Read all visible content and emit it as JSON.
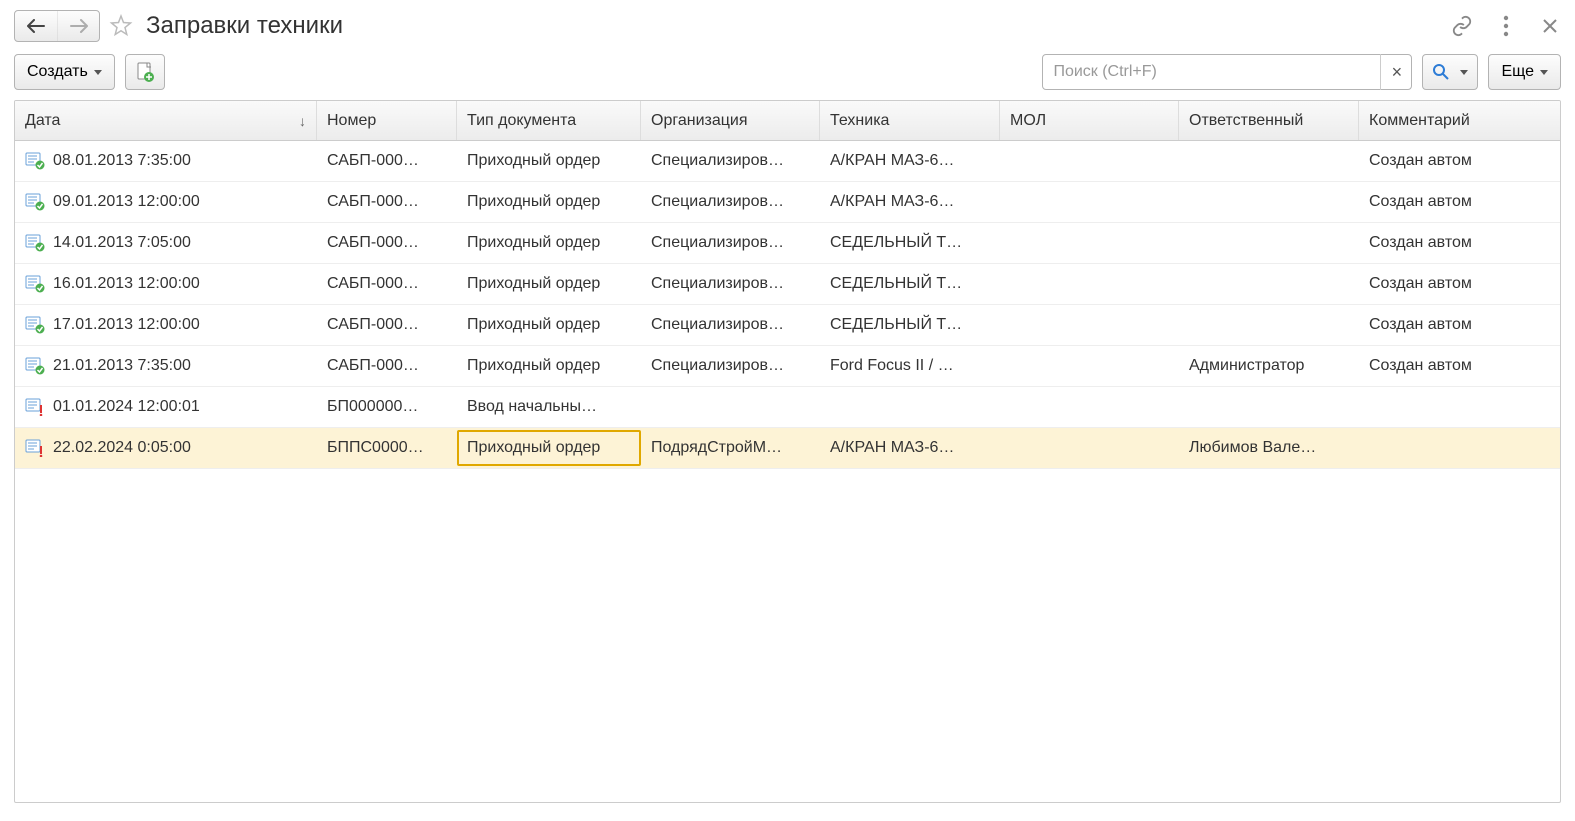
{
  "header": {
    "title": "Заправки техники"
  },
  "toolbar": {
    "create_label": "Создать",
    "more_label": "Еще"
  },
  "search": {
    "placeholder": "Поиск (Ctrl+F)",
    "clear": "×"
  },
  "table": {
    "headers": {
      "date": "Дата",
      "number": "Номер",
      "doc_type": "Тип документа",
      "org": "Организация",
      "tech": "Техника",
      "mol": "МОЛ",
      "resp": "Ответственный",
      "comment": "Комментарий"
    },
    "sort_indicator": "↓",
    "rows": [
      {
        "icon": "posted",
        "date": "08.01.2013 7:35:00",
        "number": "САБП-000…",
        "doc_type": "Приходный ордер",
        "org": "Специализиров…",
        "tech": "А/КРАН МАЗ-6…",
        "mol": "",
        "resp": "",
        "comment": "Создан автом"
      },
      {
        "icon": "posted",
        "date": "09.01.2013 12:00:00",
        "number": "САБП-000…",
        "doc_type": "Приходный ордер",
        "org": "Специализиров…",
        "tech": "А/КРАН МАЗ-6…",
        "mol": "",
        "resp": "",
        "comment": "Создан автом"
      },
      {
        "icon": "posted",
        "date": "14.01.2013 7:05:00",
        "number": "САБП-000…",
        "doc_type": "Приходный ордер",
        "org": "Специализиров…",
        "tech": "СЕДЕЛЬНЫЙ Т…",
        "mol": "",
        "resp": "",
        "comment": "Создан автом"
      },
      {
        "icon": "posted",
        "date": "16.01.2013 12:00:00",
        "number": "САБП-000…",
        "doc_type": "Приходный ордер",
        "org": "Специализиров…",
        "tech": "СЕДЕЛЬНЫЙ Т…",
        "mol": "",
        "resp": "",
        "comment": "Создан автом"
      },
      {
        "icon": "posted",
        "date": "17.01.2013 12:00:00",
        "number": "САБП-000…",
        "doc_type": "Приходный ордер",
        "org": "Специализиров…",
        "tech": "СЕДЕЛЬНЫЙ Т…",
        "mol": "",
        "resp": "",
        "comment": "Создан автом"
      },
      {
        "icon": "posted",
        "date": "21.01.2013 7:35:00",
        "number": "САБП-000…",
        "doc_type": "Приходный ордер",
        "org": "Специализиров…",
        "tech": "Ford Focus II / …",
        "mol": "",
        "resp": "Администратор",
        "comment": "Создан автом"
      },
      {
        "icon": "draft",
        "date": "01.01.2024 12:00:01",
        "number": "БП000000…",
        "doc_type": "Ввод начальны…",
        "org": "",
        "tech": "",
        "mol": "",
        "resp": "",
        "comment": ""
      },
      {
        "icon": "draft",
        "date": "22.02.2024 0:05:00",
        "number": "БППС0000…",
        "doc_type": "Приходный ордер",
        "org": "ПодрядСтройМ…",
        "tech": "А/КРАН МАЗ-6…",
        "mol": "",
        "resp": "Любимов Вале…",
        "comment": "",
        "selected": true,
        "focus_col": "doc_type"
      }
    ]
  }
}
